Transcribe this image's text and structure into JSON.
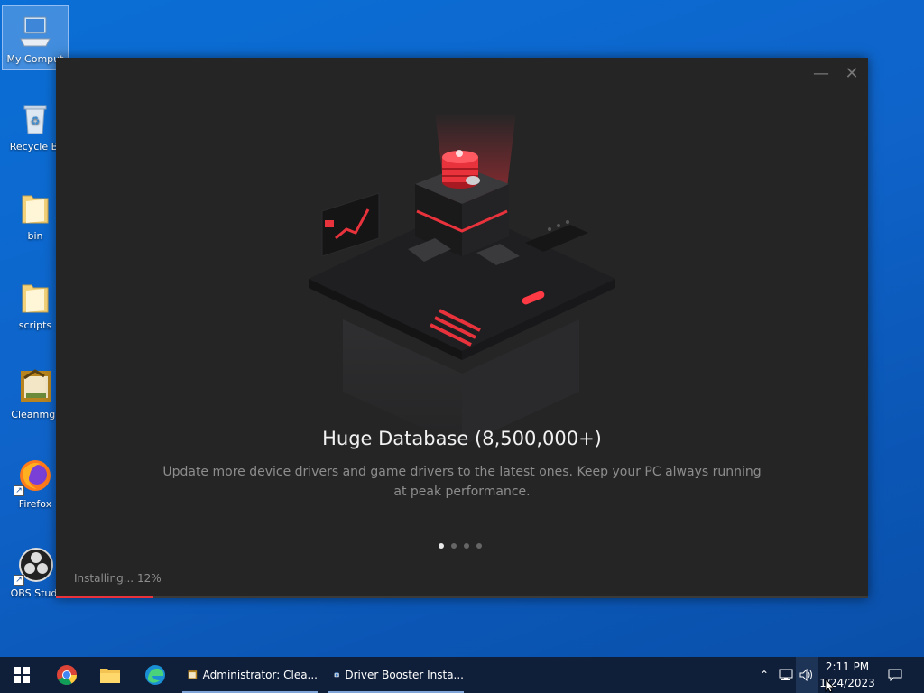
{
  "desktop": {
    "icons": [
      {
        "label": "My Comput"
      },
      {
        "label": "Recycle Bi"
      },
      {
        "label": "bin"
      },
      {
        "label": "scripts"
      },
      {
        "label": "Cleanmgr"
      },
      {
        "label": "Firefox"
      },
      {
        "label": "OBS Studi"
      }
    ]
  },
  "installer": {
    "title": "Huge Database (8,500,000+)",
    "description": "Update more device drivers and game drivers to the latest ones. Keep your PC always running at peak performance.",
    "status": "Installing... 12%",
    "progress": 0.12,
    "slide_count": 4,
    "active_slide": 0,
    "accent": "#e8323c"
  },
  "taskbar": {
    "apps": [
      {
        "label": "Administrator: Clea..."
      },
      {
        "label": "Driver Booster Insta..."
      }
    ],
    "clock": {
      "time": "2:11 PM",
      "date": "1/24/2023"
    }
  }
}
